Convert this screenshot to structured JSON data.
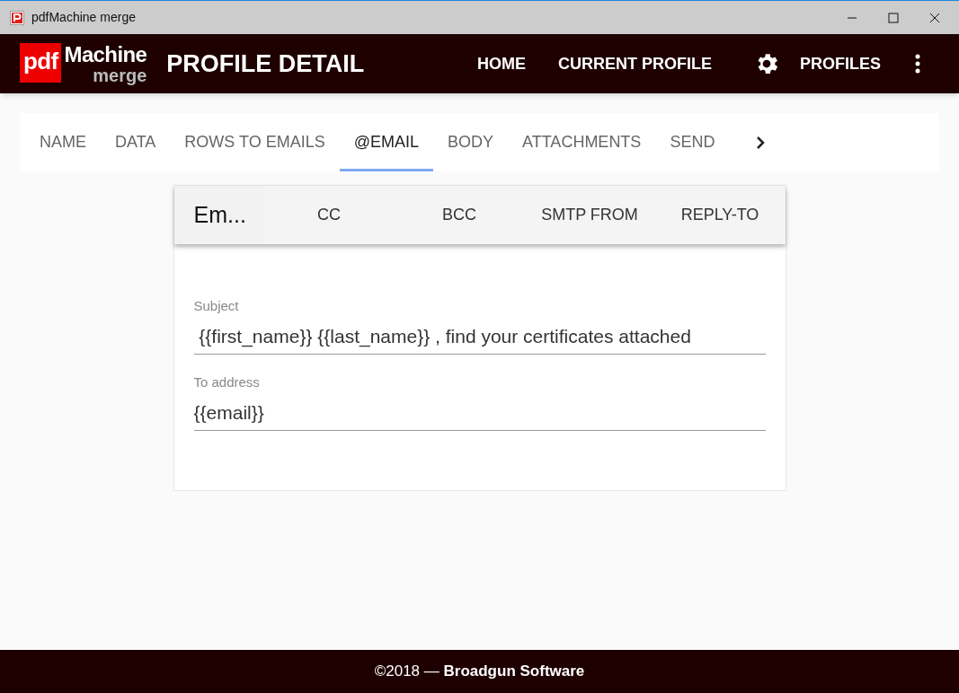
{
  "window": {
    "title": "pdfMachine merge"
  },
  "header": {
    "logo": {
      "brand": "pdf",
      "product": "Machine",
      "sub": "merge"
    },
    "title": "PROFILE DETAIL",
    "nav": [
      {
        "label": "HOME",
        "kind": "link"
      },
      {
        "label": "CURRENT PROFILE",
        "kind": "link"
      },
      {
        "label": "PROFILES",
        "kind": "settings"
      }
    ]
  },
  "tabs": [
    {
      "label": "NAME",
      "selected": false
    },
    {
      "label": "DATA",
      "selected": false
    },
    {
      "label": "ROWS TO EMAILS",
      "selected": false
    },
    {
      "label": "@EMAIL",
      "selected": true
    },
    {
      "label": "BODY",
      "selected": false
    },
    {
      "label": "ATTACHMENTS",
      "selected": false
    },
    {
      "label": "SEND",
      "selected": false
    }
  ],
  "sub_tabs": [
    {
      "label": "Em...",
      "selected": true
    },
    {
      "label": "CC",
      "selected": false
    },
    {
      "label": "BCC",
      "selected": false
    },
    {
      "label": "SMTP FROM",
      "selected": false
    },
    {
      "label": "REPLY-TO",
      "selected": false
    }
  ],
  "fields": [
    {
      "label": "Subject",
      "value": " {{first_name}} {{last_name}} , find your certificates attached"
    },
    {
      "label": "To address",
      "value": "{{email}}"
    }
  ],
  "footer": "©2018 — **Broadgun Software**"
}
